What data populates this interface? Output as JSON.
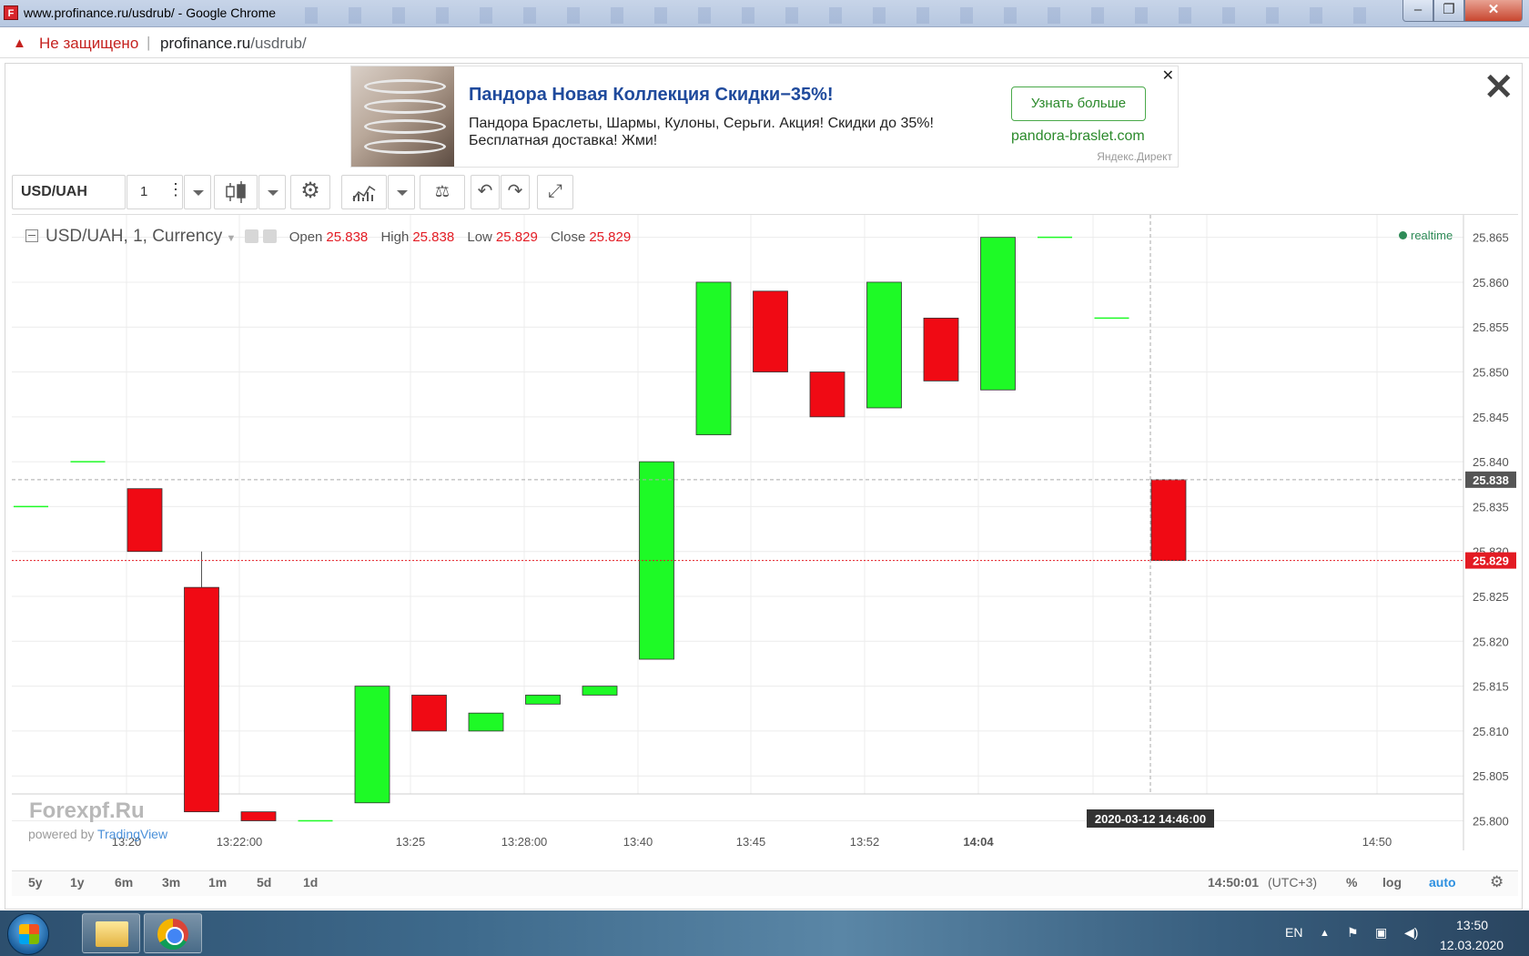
{
  "window": {
    "title": "www.profinance.ru/usdrub/ - Google Chrome",
    "favicon_text": "F"
  },
  "addressbar": {
    "security_text": "Не защищено",
    "url_host": "profinance.ru",
    "url_path": "/usdrub/"
  },
  "ad": {
    "headline": "Пандора Новая Коллекция Скидки−35%!",
    "body": "Пандора Браслеты, Шармы, Кулоны, Серьги. Акция! Скидки до 35%! Бесплатная доставка! Жми!",
    "cta": "Узнать больше",
    "domain": "pandora-braslet.com",
    "network": "Яндекс.Директ",
    "close": "✕"
  },
  "page_close": "✕",
  "toolbar": {
    "symbol": "USD/UAH",
    "interval": "1",
    "undo": "↶",
    "redo": "↷",
    "settings_icon": "⚙",
    "compare_icon": "⚖",
    "fullscreen_icon": "⤢"
  },
  "legend": {
    "title": "USD/UAH, 1, Currency",
    "open_label": "Open",
    "open": "25.838",
    "high_label": "High",
    "high": "25.838",
    "low_label": "Low",
    "low": "25.829",
    "close_label": "Close",
    "close": "25.829"
  },
  "realtime": "realtime",
  "watermark": "Forexpf.Ru",
  "powered_by": "powered by",
  "tradingview": "TradingView",
  "chart_data": {
    "type": "candlestick",
    "y_range": [
      25.7965,
      25.8675
    ],
    "y_ticks": [
      "25.865",
      "25.860",
      "25.855",
      "25.850",
      "25.845",
      "25.840",
      "25.835",
      "25.830",
      "25.825",
      "25.820",
      "25.815",
      "25.810",
      "25.805",
      "25.800"
    ],
    "x_ticks": [
      {
        "label": "13:20",
        "bold": false
      },
      {
        "label": "13:22:00",
        "bold": false
      },
      {
        "label": "13:25",
        "bold": false
      },
      {
        "label": "13:28:00",
        "bold": false
      },
      {
        "label": "13:40",
        "bold": false
      },
      {
        "label": "13:45",
        "bold": false
      },
      {
        "label": "13:52",
        "bold": false
      },
      {
        "label": "14:04",
        "bold": true
      },
      {
        "label": "14:50",
        "bold": false
      }
    ],
    "crosshair_label": "2020-03-12 14:46:00",
    "price_marker_current": "25.829",
    "price_marker_crosshair": "25.838",
    "current_price": 25.829,
    "crosshair_price": 25.838,
    "candles": [
      {
        "o": 25.835,
        "h": 25.835,
        "l": 25.835,
        "c": 25.835
      },
      {
        "o": 25.84,
        "h": 25.84,
        "l": 25.84,
        "c": 25.84
      },
      {
        "o": 25.837,
        "h": 25.837,
        "l": 25.83,
        "c": 25.83
      },
      {
        "o": 25.826,
        "h": 25.83,
        "l": 25.801,
        "c": 25.801
      },
      {
        "o": 25.801,
        "h": 25.801,
        "l": 25.8,
        "c": 25.8
      },
      {
        "o": 25.8,
        "h": 25.8,
        "l": 25.8,
        "c": 25.8
      },
      {
        "o": 25.802,
        "h": 25.815,
        "l": 25.802,
        "c": 25.815
      },
      {
        "o": 25.814,
        "h": 25.814,
        "l": 25.81,
        "c": 25.81
      },
      {
        "o": 25.81,
        "h": 25.812,
        "l": 25.81,
        "c": 25.812
      },
      {
        "o": 25.813,
        "h": 25.814,
        "l": 25.813,
        "c": 25.814
      },
      {
        "o": 25.814,
        "h": 25.815,
        "l": 25.814,
        "c": 25.815
      },
      {
        "o": 25.818,
        "h": 25.84,
        "l": 25.818,
        "c": 25.84
      },
      {
        "o": 25.843,
        "h": 25.86,
        "l": 25.843,
        "c": 25.86
      },
      {
        "o": 25.859,
        "h": 25.859,
        "l": 25.85,
        "c": 25.85
      },
      {
        "o": 25.85,
        "h": 25.85,
        "l": 25.845,
        "c": 25.845
      },
      {
        "o": 25.846,
        "h": 25.86,
        "l": 25.846,
        "c": 25.86
      },
      {
        "o": 25.856,
        "h": 25.856,
        "l": 25.849,
        "c": 25.849
      },
      {
        "o": 25.848,
        "h": 25.865,
        "l": 25.848,
        "c": 25.865
      },
      {
        "o": 25.865,
        "h": 25.865,
        "l": 25.865,
        "c": 25.865
      },
      {
        "o": 25.856,
        "h": 25.856,
        "l": 25.856,
        "c": 25.856
      },
      {
        "o": 25.838,
        "h": 25.838,
        "l": 25.829,
        "c": 25.829
      }
    ],
    "colors": {
      "up": "#1efa26",
      "down": "#f00a14",
      "grid": "#ececec",
      "current_price": "#e31b23",
      "crosshair": "#555555"
    }
  },
  "bottombar": {
    "ranges": [
      "5y",
      "1y",
      "6m",
      "3m",
      "1m",
      "5d",
      "1d"
    ],
    "time": "14:50:01",
    "tz": "(UTC+3)",
    "percent": "%",
    "log": "log",
    "auto": "auto",
    "gear_icon": "⚙"
  },
  "taskbar": {
    "lang": "EN",
    "time": "13:50",
    "date": "12.03.2020"
  }
}
